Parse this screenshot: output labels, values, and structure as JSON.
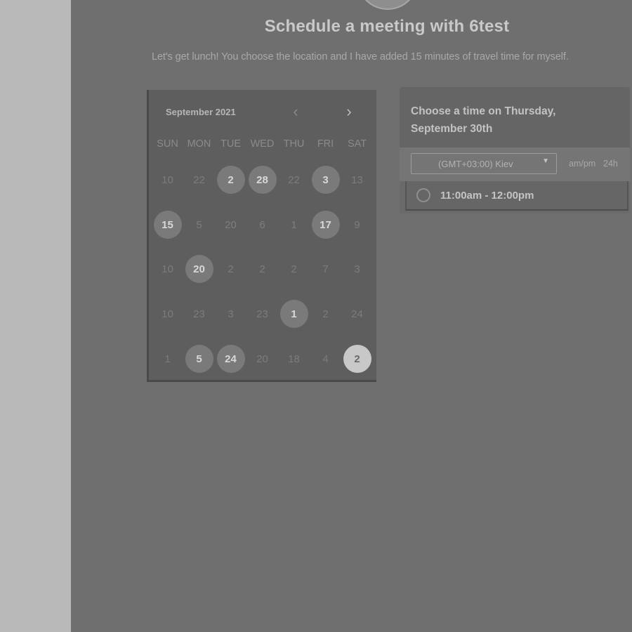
{
  "page": {
    "title": "Schedule a meeting with 6test",
    "subtitle": "Let's get lunch! You choose the location and I have added 15 minutes of travel time for myself."
  },
  "calendar": {
    "month_label": "September 2021",
    "prev_icon": "chevron-left-icon",
    "next_icon": "chevron-right-icon",
    "weekdays": [
      "SUN",
      "MON",
      "TUE",
      "WED",
      "THU",
      "FRI",
      "SAT"
    ],
    "weeks": [
      [
        {
          "d": "10",
          "s": "off"
        },
        {
          "d": "22",
          "s": "off"
        },
        {
          "d": "2",
          "s": "avail"
        },
        {
          "d": "28",
          "s": "avail"
        },
        {
          "d": "22",
          "s": "off"
        },
        {
          "d": "3",
          "s": "avail"
        },
        {
          "d": "13",
          "s": "off"
        }
      ],
      [
        {
          "d": "15",
          "s": "avail"
        },
        {
          "d": "5",
          "s": "off"
        },
        {
          "d": "20",
          "s": "off"
        },
        {
          "d": "6",
          "s": "off"
        },
        {
          "d": "1",
          "s": "off"
        },
        {
          "d": "17",
          "s": "avail"
        },
        {
          "d": "9",
          "s": "off"
        }
      ],
      [
        {
          "d": "10",
          "s": "off"
        },
        {
          "d": "20",
          "s": "avail"
        },
        {
          "d": "2",
          "s": "off"
        },
        {
          "d": "2",
          "s": "off"
        },
        {
          "d": "2",
          "s": "off"
        },
        {
          "d": "7",
          "s": "off"
        },
        {
          "d": "3",
          "s": "off"
        }
      ],
      [
        {
          "d": "10",
          "s": "off"
        },
        {
          "d": "23",
          "s": "off"
        },
        {
          "d": "3",
          "s": "off"
        },
        {
          "d": "23",
          "s": "off"
        },
        {
          "d": "1",
          "s": "avail"
        },
        {
          "d": "2",
          "s": "off"
        },
        {
          "d": "24",
          "s": "off"
        }
      ],
      [
        {
          "d": "1",
          "s": "off"
        },
        {
          "d": "5",
          "s": "avail"
        },
        {
          "d": "24",
          "s": "avail"
        },
        {
          "d": "20",
          "s": "off"
        },
        {
          "d": "18",
          "s": "off"
        },
        {
          "d": "4",
          "s": "off"
        },
        {
          "d": "2",
          "s": "selected"
        }
      ]
    ]
  },
  "time_panel": {
    "title": "Choose a time on Thursday, September 30th",
    "timezone": "(GMT+03:00) Kiev",
    "caret_icon": "caret-down-icon",
    "format_ampm": "am/pm",
    "format_24h": "24h",
    "slots": [
      "11:00am - 12:00pm"
    ]
  },
  "colors": {
    "background": "#6f6f6f",
    "sidebar": "#b9b9b9",
    "selected_day": "#c8c8c8",
    "available_day": "#7a7a7a"
  }
}
